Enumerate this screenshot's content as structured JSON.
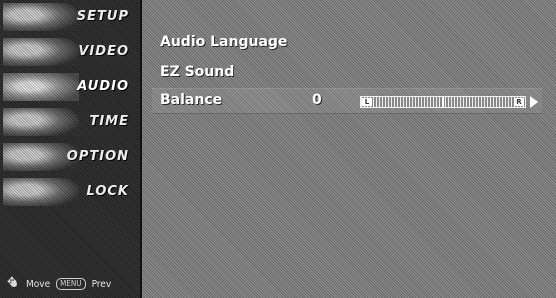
{
  "sidebar": {
    "items": [
      {
        "label": "SETUP",
        "icon": "setup-icon"
      },
      {
        "label": "VIDEO",
        "icon": "video-icon"
      },
      {
        "label": "AUDIO",
        "icon": "audio-icon"
      },
      {
        "label": "TIME",
        "icon": "time-icon"
      },
      {
        "label": "OPTION",
        "icon": "option-icon"
      },
      {
        "label": "LOCK",
        "icon": "lock-icon"
      }
    ],
    "active": "AUDIO",
    "hint": {
      "move_label": "Move",
      "menu_key": "MENU",
      "prev_label": "Prev"
    }
  },
  "main": {
    "options": [
      {
        "label": "Audio Language"
      },
      {
        "label": "EZ Sound"
      },
      {
        "label": "Balance",
        "value": "0"
      }
    ],
    "balance": {
      "left_label": "L",
      "right_label": "R",
      "position": 0.5
    }
  },
  "colors": {
    "text": "#ffffff",
    "sidebar_bg": "#2a2a2a",
    "content_bg": "#888888"
  }
}
